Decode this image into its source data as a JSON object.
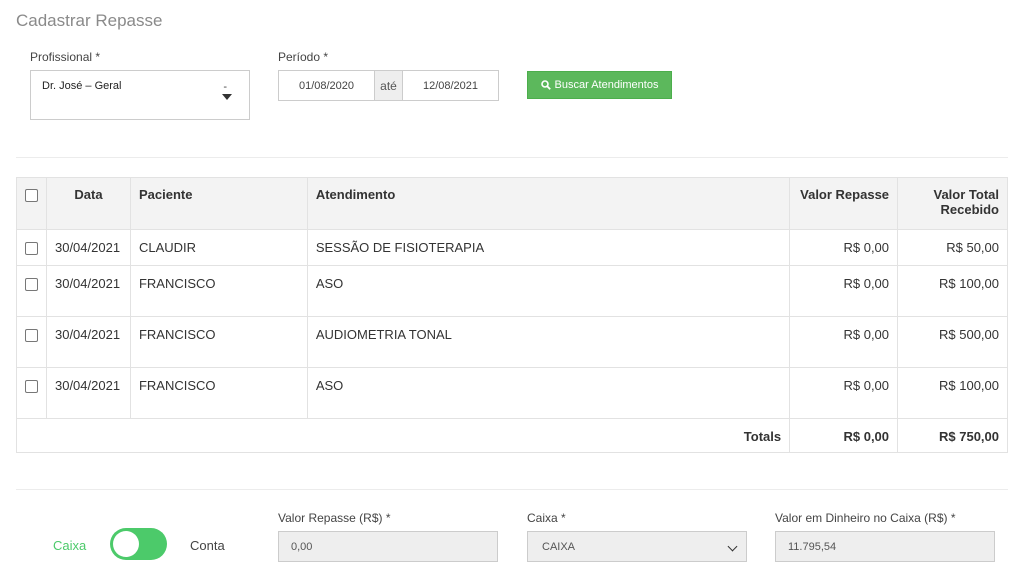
{
  "page": {
    "title": "Cadastrar Repasse"
  },
  "filters": {
    "profissional_label": "Profissional *",
    "profissional_value": "Dr. José –  Geral",
    "profissional_suffix": "-",
    "periodo_label": "Período *",
    "date_from": "01/08/2020",
    "date_sep": "até",
    "date_to": "12/08/2021",
    "search_button": "Buscar Atendimentos",
    "search_button_color": "#5cb85c"
  },
  "table": {
    "headers": [
      "Data",
      "Paciente",
      "Atendimento",
      "Valor Repasse",
      "Valor Total Recebido"
    ],
    "rows": [
      {
        "data": "30/04/2021",
        "paciente": "CLAUDIR",
        "atendimento": "SESSÃO DE FISIOTERAPIA",
        "repasse": "R$ 0,00",
        "total": "R$ 50,00"
      },
      {
        "data": "30/04/2021",
        "paciente": "FRANCISCO",
        "atendimento": "ASO",
        "repasse": "R$ 0,00",
        "total": "R$ 100,00"
      },
      {
        "data": "30/04/2021",
        "paciente": "FRANCISCO",
        "atendimento": "AUDIOMETRIA TONAL",
        "repasse": "R$ 0,00",
        "total": "R$ 500,00"
      },
      {
        "data": "30/04/2021",
        "paciente": "FRANCISCO",
        "atendimento": "ASO",
        "repasse": "R$ 0,00",
        "total": "R$ 100,00"
      }
    ],
    "totals_label": "Totals",
    "totals_repasse": "R$ 0,00",
    "totals_total": "R$ 750,00"
  },
  "footer": {
    "toggle_left": "Caixa",
    "toggle_right": "Conta",
    "toggle_color": "#4cca6a",
    "valor_repasse_label": "Valor Repasse (R$) *",
    "valor_repasse_value": "0,00",
    "caixa_label": "Caixa *",
    "caixa_value": "CAIXA",
    "dinheiro_label": "Valor em Dinheiro no Caixa (R$) *",
    "dinheiro_value": "11.795,54"
  }
}
